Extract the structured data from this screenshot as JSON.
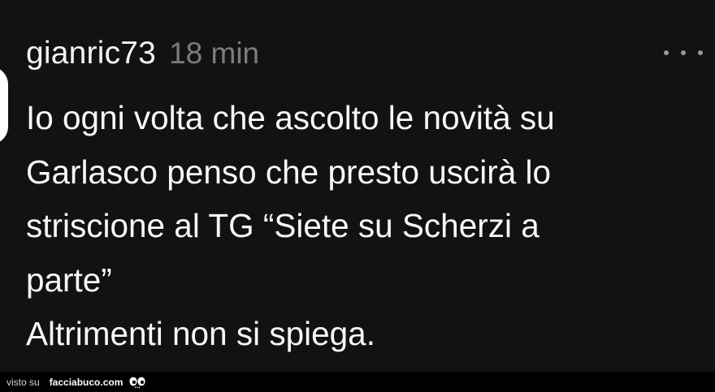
{
  "comment": {
    "username": "gianric73",
    "timestamp": "18 min",
    "more_icon": "more-horizontal-icon",
    "text_lines": [
      "Io ogni volta che ascolto le novità su",
      "Garlasco penso che presto uscirà lo",
      "striscione al TG “Siete su Scherzi a",
      "parte”",
      "Altrimenti non si spiega."
    ]
  },
  "watermark": {
    "prefix": "visto su",
    "brand": "facciabuco.com",
    "logo_icon": "eyes-logo-icon"
  },
  "colors": {
    "background": "#121212",
    "text": "#f7f7f7",
    "timestamp": "#7c7c7c",
    "footer_bar": "#000000"
  }
}
